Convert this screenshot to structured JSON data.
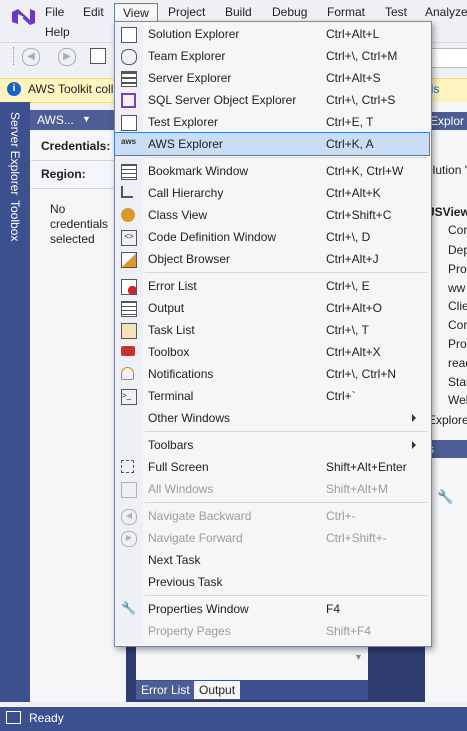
{
  "menubar": {
    "items": [
      "File",
      "Edit",
      "View",
      "Project",
      "Build",
      "Debug",
      "Format",
      "Test",
      "Analyze",
      "Help"
    ]
  },
  "infobar": {
    "text": "AWS Toolkit coll",
    "link": "ils"
  },
  "left_tabs": {
    "server_explorer": "Server Explorer",
    "toolbox": "Toolbox"
  },
  "aws_panel": {
    "title": "AWS...",
    "credentials_label": "Credentials:",
    "region_label": "Region:",
    "message": [
      "No",
      "credentials",
      "selected"
    ]
  },
  "right_panel": {
    "header": "Explor",
    "search": "olution 'J",
    "items": [
      "JSView",
      "Cor",
      "Dep",
      "Pro",
      "ww",
      "Clie",
      "Cor",
      "Pro",
      "read",
      "Star",
      "Wel"
    ],
    "footer": "Explore",
    "props_header": "s"
  },
  "bottom_tabs": [
    "Error List",
    "Output"
  ],
  "status": {
    "text": "Ready"
  },
  "view_menu": {
    "items": [
      {
        "label": "Solution Explorer",
        "shortcut": "Ctrl+Alt+L",
        "icon": "solution-explorer-icon"
      },
      {
        "label": "Team Explorer",
        "shortcut": "Ctrl+\\, Ctrl+M",
        "icon": "team-explorer-icon"
      },
      {
        "label": "Server Explorer",
        "shortcut": "Ctrl+Alt+S",
        "icon": "server-explorer-icon"
      },
      {
        "label": "SQL Server Object Explorer",
        "shortcut": "Ctrl+\\, Ctrl+S",
        "icon": "sql-server-icon"
      },
      {
        "label": "Test Explorer",
        "shortcut": "Ctrl+E, T",
        "icon": "test-explorer-icon"
      },
      {
        "label": "AWS Explorer",
        "shortcut": "Ctrl+K, A",
        "icon": "aws-icon"
      },
      {
        "label": "Bookmark Window",
        "shortcut": "Ctrl+K, Ctrl+W",
        "icon": "bookmark-icon"
      },
      {
        "label": "Call Hierarchy",
        "shortcut": "Ctrl+Alt+K",
        "icon": "call-hierarchy-icon"
      },
      {
        "label": "Class View",
        "shortcut": "Ctrl+Shift+C",
        "icon": "class-view-icon"
      },
      {
        "label": "Code Definition Window",
        "shortcut": "Ctrl+\\, D",
        "icon": "code-definition-icon"
      },
      {
        "label": "Object Browser",
        "shortcut": "Ctrl+Alt+J",
        "icon": "object-browser-icon"
      },
      {
        "label": "Error List",
        "shortcut": "Ctrl+\\, E",
        "icon": "error-list-icon"
      },
      {
        "label": "Output",
        "shortcut": "Ctrl+Alt+O",
        "icon": "output-icon"
      },
      {
        "label": "Task List",
        "shortcut": "Ctrl+\\, T",
        "icon": "task-list-icon"
      },
      {
        "label": "Toolbox",
        "shortcut": "Ctrl+Alt+X",
        "icon": "toolbox-icon"
      },
      {
        "label": "Notifications",
        "shortcut": "Ctrl+\\, Ctrl+N",
        "icon": "bell-icon"
      },
      {
        "label": "Terminal",
        "shortcut": "Ctrl+`",
        "icon": "terminal-icon"
      },
      {
        "label": "Other Windows",
        "shortcut": "",
        "icon": ""
      },
      {
        "label": "Toolbars",
        "shortcut": "",
        "icon": ""
      },
      {
        "label": "Full Screen",
        "shortcut": "Shift+Alt+Enter",
        "icon": "full-screen-icon"
      },
      {
        "label": "All Windows",
        "shortcut": "Shift+Alt+M",
        "icon": "all-windows-icon"
      },
      {
        "label": "Navigate Backward",
        "shortcut": "Ctrl+-",
        "icon": "navigate-backward-icon"
      },
      {
        "label": "Navigate Forward",
        "shortcut": "Ctrl+Shift+-",
        "icon": "navigate-forward-icon"
      },
      {
        "label": "Next Task",
        "shortcut": "",
        "icon": ""
      },
      {
        "label": "Previous Task",
        "shortcut": "",
        "icon": ""
      },
      {
        "label": "Properties Window",
        "shortcut": "F4",
        "icon": "wrench-icon"
      },
      {
        "label": "Property Pages",
        "shortcut": "Shift+F4",
        "icon": ""
      }
    ]
  }
}
